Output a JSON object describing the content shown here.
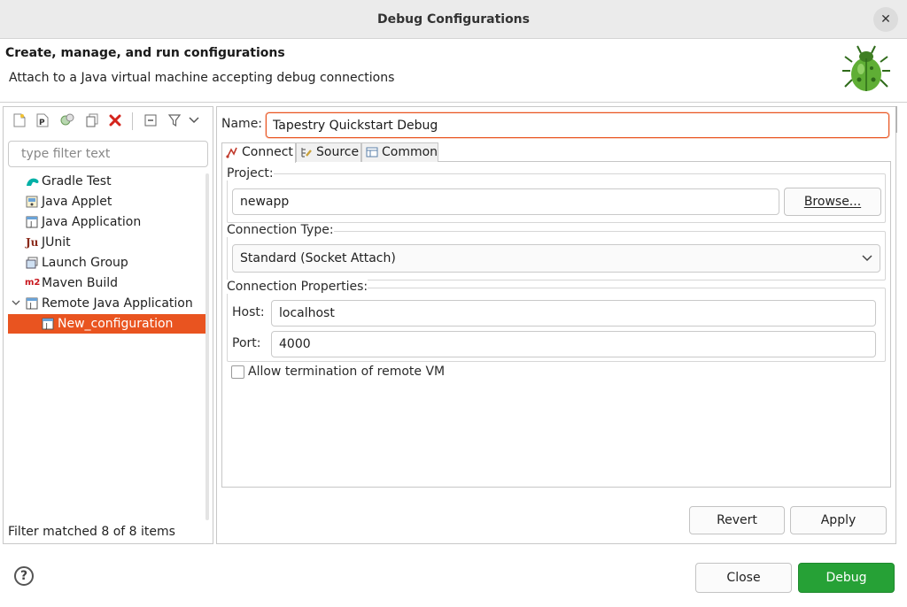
{
  "window": {
    "title": "Debug Configurations",
    "close_glyph": "✕"
  },
  "header": {
    "title": "Create, manage, and run configurations",
    "description": "Attach to a Java virtual machine accepting debug connections",
    "icon": "bug-icon"
  },
  "sidebar": {
    "filter_placeholder": "type filter text",
    "items": [
      {
        "label": "Gradle Test",
        "icon": "gradle-icon"
      },
      {
        "label": "Java Applet",
        "icon": "java-applet-icon"
      },
      {
        "label": "Java Application",
        "icon": "java-application-icon"
      },
      {
        "label": "JUnit",
        "icon": "junit-icon",
        "icon_text": "Ju"
      },
      {
        "label": "Launch Group",
        "icon": "launch-group-icon"
      },
      {
        "label": "Maven Build",
        "icon": "maven-icon",
        "icon_text": "m2"
      },
      {
        "label": "Remote Java Application",
        "icon": "remote-java-icon",
        "expanded": true
      },
      {
        "label": "New_configuration",
        "icon": "config-icon",
        "selected": true
      }
    ],
    "status": "Filter matched 8 of 8 items"
  },
  "main": {
    "name_label": "Name:",
    "name_value": "Tapestry Quickstart Debug",
    "tabs": [
      {
        "label": "Connect",
        "active": true
      },
      {
        "label": "Source",
        "active": false
      },
      {
        "label": "Common",
        "active": false
      }
    ],
    "project": {
      "label": "Project:",
      "value": "newapp",
      "browse_label": "Browse..."
    },
    "connection_type": {
      "label": "Connection Type:",
      "value": "Standard (Socket Attach)"
    },
    "connection_properties": {
      "label": "Connection Properties:",
      "host_label": "Host:",
      "host_value": "localhost",
      "port_label": "Port:",
      "port_value": "4000"
    },
    "allow_termination": {
      "label": "Allow termination of remote VM",
      "checked": false
    },
    "revert_label": "Revert",
    "apply_label": "Apply"
  },
  "footer": {
    "close_label": "Close",
    "debug_label": "Debug",
    "help_glyph": "?"
  },
  "colors": {
    "accent": "#e95420",
    "debug_green": "#26a136"
  }
}
